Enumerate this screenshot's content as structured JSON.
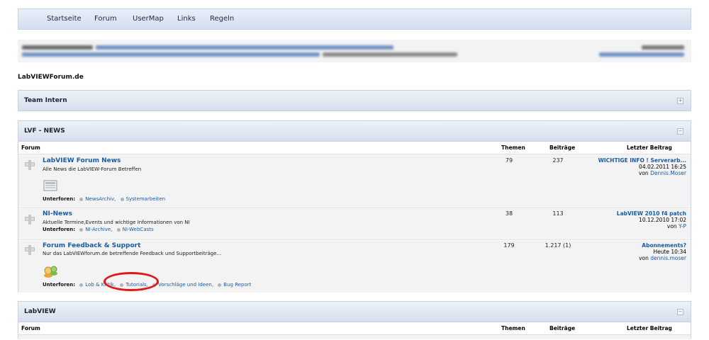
{
  "nav": {
    "items": [
      "Startseite",
      "Forum",
      "UserMap",
      "Links",
      "Regeln"
    ]
  },
  "site": {
    "title": "LabVIEWForum.de"
  },
  "categories": {
    "team": {
      "title": "Team Intern",
      "toggle": "+"
    },
    "news": {
      "title": "LVF - NEWS",
      "toggle": "−",
      "cols": {
        "forum": "Forum",
        "themen": "Themen",
        "beitraege": "Beiträge",
        "letzter": "Letzter Beitrag"
      },
      "forums": [
        {
          "name": "LabVIEW Forum News",
          "desc": "Alle News die LabVIEW-Forum Betreffen",
          "subs_label": "Unterforen:",
          "subs": [
            "NewsArchiv,",
            "Systemarbeiten"
          ],
          "themen": "79",
          "beitraege": "237",
          "last_title": "WICHTIGE INFO ! Serverarb...",
          "last_date": "04.02.2011 16:25",
          "last_by": "von",
          "last_user": "Dennis.Moser"
        },
        {
          "name": "NI-News",
          "desc": "Aktuelle Termine,Events und wichtige Informationen von NI",
          "subs_label": "Unterforen:",
          "subs": [
            "NI-Archive,",
            "NI-WebCasts"
          ],
          "themen": "38",
          "beitraege": "113",
          "last_title": "LabVIEW 2010 f4 patch",
          "last_date": "10.12.2010 17:02",
          "last_by": "von",
          "last_user": "Y-P"
        },
        {
          "name": "Forum Feedback & Support",
          "desc": "Nur das LabVIEWforum.de betreffende Feedback und Supportbeiträge...",
          "subs_label": "Unterforen:",
          "subs": [
            "Lob & Kritik,",
            "Tutorials,",
            "Vorschläge und Ideen,",
            "Bug Report"
          ],
          "themen": "179",
          "beitraege": "1.217 (1)",
          "last_title": "Abonnements?",
          "last_date": "Heute 10:34",
          "last_by": "von",
          "last_user": "dennis.moser"
        }
      ]
    },
    "labview": {
      "title": "LabVIEW",
      "toggle": "−",
      "cols": {
        "forum": "Forum",
        "themen": "Themen",
        "beitraege": "Beiträge",
        "letzter": "Letzter Beitrag"
      }
    }
  },
  "colors": {
    "link": "#1a5ca8",
    "highlight": "#e01818"
  }
}
